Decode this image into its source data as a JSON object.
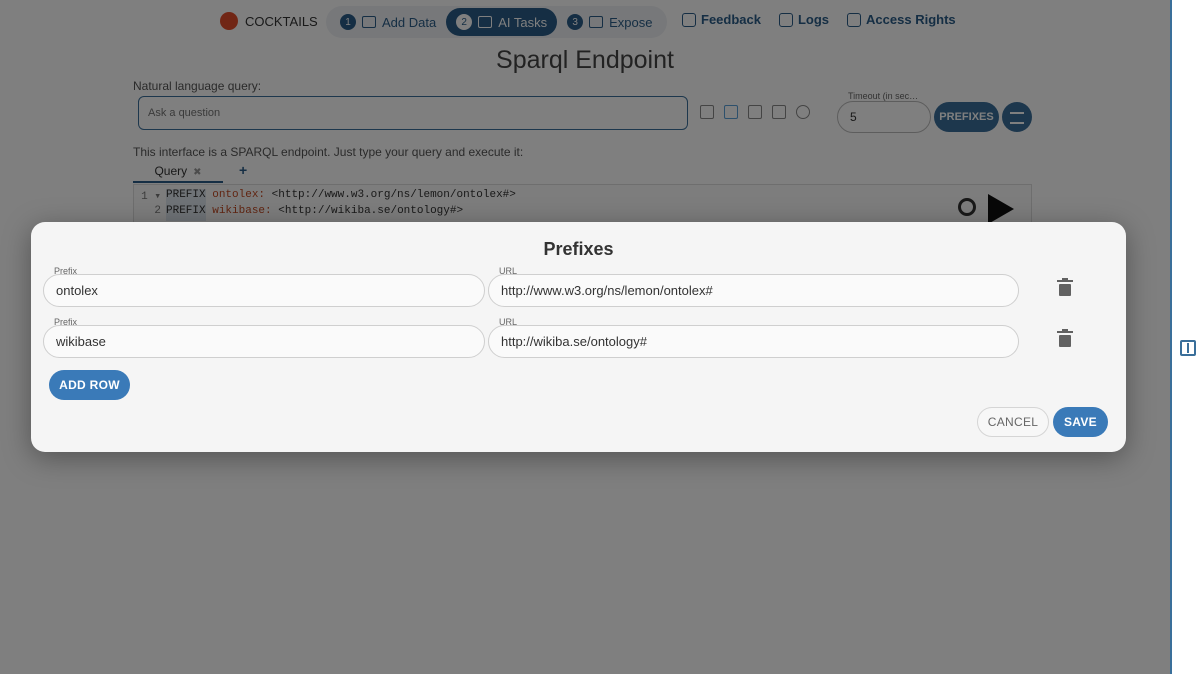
{
  "brand": {
    "name": "COCKTAILS"
  },
  "steps": [
    {
      "num": "1",
      "label": "Add Data",
      "icon": "folder-icon"
    },
    {
      "num": "2",
      "label": "AI Tasks",
      "icon": "tasks-icon"
    },
    {
      "num": "3",
      "label": "Expose",
      "icon": "chat-icon"
    }
  ],
  "nav": {
    "feedback": "Feedback",
    "logs": "Logs",
    "access": "Access Rights"
  },
  "page": {
    "title": "Sparql Endpoint",
    "nlq_label": "Natural language query:",
    "nlq_placeholder": "Ask a question",
    "timeout_label": "Timeout (in sec…",
    "timeout_value": "5",
    "prefixes_button": "PREFIXES",
    "intro": "This interface is a SPARQL endpoint. Just type your query and execute it:",
    "tab_label": "Query",
    "tab_close": "✖",
    "tab_add": "+"
  },
  "editor": {
    "lines": [
      {
        "num": "1 ▾",
        "kw": "PREFIX",
        "prefix": "ontolex:",
        "uri": "<http://www.w3.org/ns/lemon/ontolex#>"
      },
      {
        "num": "2",
        "kw": "PREFIX",
        "prefix": "wikibase:",
        "uri": "<http://wikiba.se/ontology#>"
      }
    ]
  },
  "modal": {
    "title": "Prefixes",
    "prefix_label": "Prefix",
    "url_label": "URL",
    "rows": [
      {
        "prefix": "ontolex",
        "url": "http://www.w3.org/ns/lemon/ontolex#"
      },
      {
        "prefix": "wikibase",
        "url": "http://wikiba.se/ontology#"
      }
    ],
    "add_row": "ADD ROW",
    "cancel": "CANCEL",
    "save": "SAVE"
  },
  "colors": {
    "primary": "#2a5d88",
    "button": "#3a7ab8",
    "brand_dot": "#e24d2a"
  }
}
